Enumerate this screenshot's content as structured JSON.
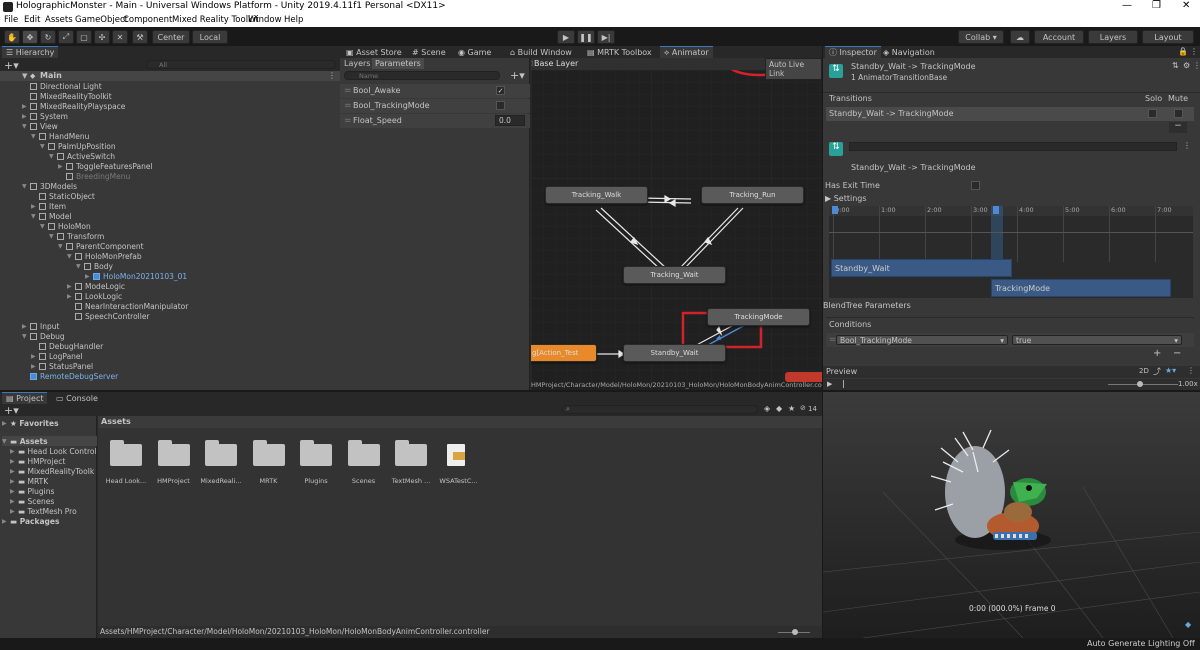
{
  "window": {
    "title": "HolographicMonster - Main - Universal Windows Platform - Unity 2019.4.11f1 Personal <DX11>",
    "min": "—",
    "max": "❐",
    "close": "✕"
  },
  "menu": [
    "File",
    "Edit",
    "Assets",
    "GameObject",
    "Component",
    "Mixed Reality Toolkit",
    "Window",
    "Help"
  ],
  "toolbar": {
    "pivot": "Center",
    "space": "Local",
    "collab": "Collab ▾",
    "account": "Account",
    "layers": "Layers",
    "layout": "Layout"
  },
  "hierarchy": {
    "tab": "Hierarchy",
    "search_placeholder": "All",
    "scene": "Main",
    "items": [
      {
        "label": "Directional Light",
        "depth": 1,
        "arrow": ""
      },
      {
        "label": "MixedRealityToolkit",
        "depth": 1,
        "arrow": ""
      },
      {
        "label": "MixedRealityPlayspace",
        "depth": 1,
        "arrow": "▶"
      },
      {
        "label": "System",
        "depth": 1,
        "arrow": "▶"
      },
      {
        "label": "View",
        "depth": 1,
        "arrow": "▼"
      },
      {
        "label": "HandMenu",
        "depth": 2,
        "arrow": "▼"
      },
      {
        "label": "PalmUpPosition",
        "depth": 3,
        "arrow": "▼"
      },
      {
        "label": "ActiveSwitch",
        "depth": 4,
        "arrow": "▼"
      },
      {
        "label": "ToggleFeaturesPanel",
        "depth": 5,
        "arrow": "▶"
      },
      {
        "label": "BreedingMenu",
        "depth": 5,
        "arrow": "",
        "dim": true
      },
      {
        "label": "3DModels",
        "depth": 1,
        "arrow": "▼"
      },
      {
        "label": "StaticObject",
        "depth": 2,
        "arrow": ""
      },
      {
        "label": "Item",
        "depth": 2,
        "arrow": "▶"
      },
      {
        "label": "Model",
        "depth": 2,
        "arrow": "▼"
      },
      {
        "label": "HoloMon",
        "depth": 3,
        "arrow": "▼"
      },
      {
        "label": "Transform",
        "depth": 4,
        "arrow": "▼"
      },
      {
        "label": "ParentComponent",
        "depth": 5,
        "arrow": "▼"
      },
      {
        "label": "HoloMonPrefab",
        "depth": 6,
        "arrow": "▼"
      },
      {
        "label": "Body",
        "depth": 7,
        "arrow": "▼"
      },
      {
        "label": "HoloMon20210103_01",
        "depth": 8,
        "arrow": "▶",
        "prefab": true
      },
      {
        "label": "ModeLogic",
        "depth": 6,
        "arrow": "▶"
      },
      {
        "label": "LookLogic",
        "depth": 6,
        "arrow": "▶"
      },
      {
        "label": "NearInteractionManipulator",
        "depth": 6,
        "arrow": ""
      },
      {
        "label": "SpeechController",
        "depth": 6,
        "arrow": ""
      },
      {
        "label": "Input",
        "depth": 1,
        "arrow": "▶"
      },
      {
        "label": "Debug",
        "depth": 1,
        "arrow": "▼"
      },
      {
        "label": "DebugHandler",
        "depth": 2,
        "arrow": ""
      },
      {
        "label": "LogPanel",
        "depth": 2,
        "arrow": "▶"
      },
      {
        "label": "StatusPanel",
        "depth": 2,
        "arrow": "▶"
      },
      {
        "label": "RemoteDebugServer",
        "depth": 1,
        "arrow": "",
        "prefab": true
      }
    ]
  },
  "center_tabs": [
    "Asset Store",
    "Scene",
    "Game",
    "Build Window",
    "MRTK Toolbox",
    "Animator"
  ],
  "animator": {
    "subtabs": [
      "Layers",
      "Parameters"
    ],
    "search_placeholder": "Name",
    "base_layer": "Base Layer",
    "auto_live": "Auto Live Link",
    "params": [
      {
        "name": "Bool_Awake",
        "value": "✓"
      },
      {
        "name": "Bool_TrackingMode",
        "value": ""
      },
      {
        "name": "Float_Speed",
        "value": "0.0"
      }
    ],
    "nodes": {
      "walk": "Tracking_Walk",
      "run": "Tracking_Run",
      "wait": "Tracking_Wait",
      "mode": "TrackingMode",
      "standby": "Standby_Wait",
      "action": "g[Action_Test"
    },
    "path": "HMProject/Character/Model/HoloMon/20210103_HoloMon/HoloMonBodyAnimController.controller"
  },
  "project": {
    "tabs": [
      "Project",
      "Console"
    ],
    "favorites": "Favorites",
    "assets": "Assets",
    "packages": "Packages",
    "count": "14",
    "tree": [
      "Head Look Control",
      "HMProject",
      "MixedRealityToolk",
      "MRTK",
      "Plugins",
      "Scenes",
      "TextMesh Pro"
    ],
    "grid": [
      "Head Look...",
      "HMProject",
      "MixedReali...",
      "MRTK",
      "Plugins",
      "Scenes",
      "TextMesh ...",
      "WSATestC..."
    ],
    "path": "Assets/HMProject/Character/Model/HoloMon/20210103_HoloMon/HoloMonBodyAnimController.controller"
  },
  "inspector": {
    "tabs": [
      "Inspector",
      "Navigation"
    ],
    "title": "Standby_Wait -> TrackingMode",
    "subtitle": "1 AnimatorTransitionBase",
    "transitions": "Transitions",
    "solo": "Solo",
    "mute": "Mute",
    "transition_row": "Standby_Wait -> TrackingMode",
    "label2": "Standby_Wait -> TrackingMode",
    "has_exit": "Has Exit Time",
    "settings": "Settings",
    "ticks": [
      "0:00",
      "1:00",
      "2:00",
      "3:00",
      "4:00",
      "5:00",
      "6:00",
      "7:00"
    ],
    "bar1": "Standby_Wait",
    "bar2": "TrackingMode",
    "blend": "BlendTree Parameters",
    "conditions": "Conditions",
    "cond_param": "Bool_TrackingMode",
    "cond_val": "true",
    "preview": "Preview",
    "mode2d": "2D",
    "speed": "1.00x",
    "frame": "0:00 (000.0%) Frame 0"
  },
  "status": "Auto Generate Lighting Off",
  "colors": {
    "accent": "#3a79bb",
    "highlight": "#d2232a",
    "orange": "#e8892a"
  }
}
